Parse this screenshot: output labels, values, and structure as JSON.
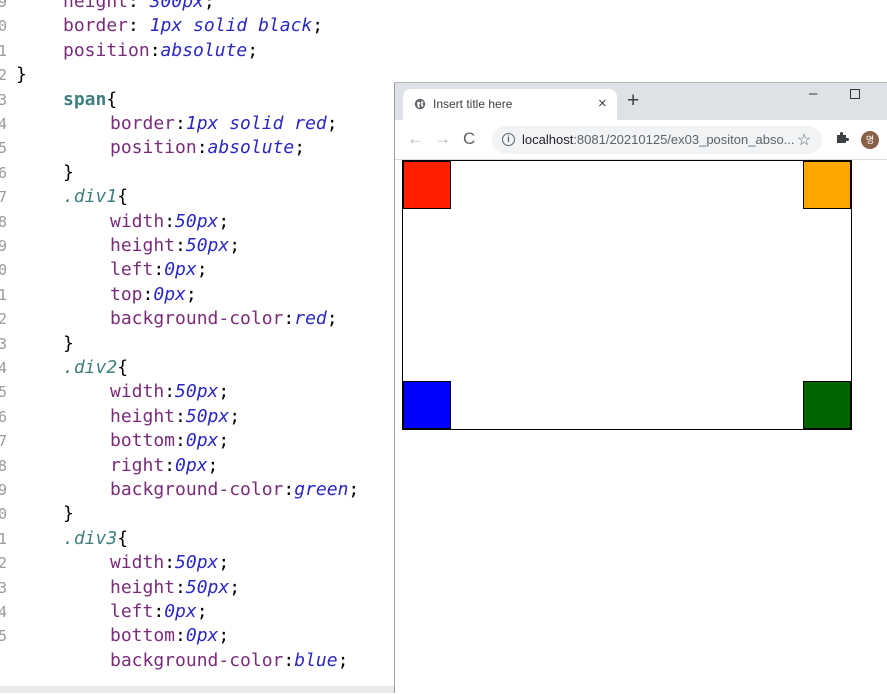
{
  "editor": {
    "line_numbers": [
      "9",
      "0",
      "1",
      "2",
      "3",
      "4",
      "5",
      "6",
      "7",
      "8",
      "9",
      "0",
      "1",
      "2",
      "3",
      "4",
      "5",
      "6",
      "7",
      "8",
      "9",
      "0",
      "1",
      "2",
      "3",
      "4",
      "5"
    ],
    "lines": [
      {
        "indent": 1,
        "tokens": [
          [
            "prop",
            "height"
          ],
          [
            "punc",
            ": "
          ],
          [
            "val",
            "300px"
          ],
          [
            "punc",
            ";"
          ]
        ]
      },
      {
        "indent": 1,
        "tokens": [
          [
            "prop",
            "border"
          ],
          [
            "punc",
            ": "
          ],
          [
            "val",
            "1px solid black"
          ],
          [
            "punc",
            ";"
          ]
        ]
      },
      {
        "indent": 1,
        "tokens": [
          [
            "prop",
            "position"
          ],
          [
            "punc",
            ":"
          ],
          [
            "val",
            "absolute"
          ],
          [
            "punc",
            ";"
          ]
        ]
      },
      {
        "indent": 0,
        "tokens": [
          [
            "punc",
            "}"
          ]
        ]
      },
      {
        "indent": 1,
        "tokens": [
          [
            "tag",
            "span"
          ],
          [
            "punc",
            "{"
          ]
        ]
      },
      {
        "indent": 2,
        "tokens": [
          [
            "prop",
            "border"
          ],
          [
            "punc",
            ":"
          ],
          [
            "val",
            "1px solid red"
          ],
          [
            "punc",
            ";"
          ]
        ]
      },
      {
        "indent": 2,
        "tokens": [
          [
            "prop",
            "position"
          ],
          [
            "punc",
            ":"
          ],
          [
            "val",
            "absolute"
          ],
          [
            "punc",
            ";"
          ]
        ]
      },
      {
        "indent": 1,
        "tokens": [
          [
            "punc",
            "}"
          ]
        ]
      },
      {
        "indent": 1,
        "tokens": [
          [
            "sel",
            ".div1"
          ],
          [
            "punc",
            "{"
          ]
        ]
      },
      {
        "indent": 2,
        "tokens": [
          [
            "prop",
            "width"
          ],
          [
            "punc",
            ":"
          ],
          [
            "val",
            "50px"
          ],
          [
            "punc",
            ";"
          ]
        ]
      },
      {
        "indent": 2,
        "tokens": [
          [
            "prop",
            "height"
          ],
          [
            "punc",
            ":"
          ],
          [
            "val",
            "50px"
          ],
          [
            "punc",
            ";"
          ]
        ]
      },
      {
        "indent": 2,
        "tokens": [
          [
            "prop",
            "left"
          ],
          [
            "punc",
            ":"
          ],
          [
            "val",
            "0px"
          ],
          [
            "punc",
            ";"
          ]
        ]
      },
      {
        "indent": 2,
        "tokens": [
          [
            "prop",
            "top"
          ],
          [
            "punc",
            ":"
          ],
          [
            "val",
            "0px"
          ],
          [
            "punc",
            ";"
          ]
        ]
      },
      {
        "indent": 2,
        "tokens": [
          [
            "prop",
            "background-color"
          ],
          [
            "punc",
            ":"
          ],
          [
            "val",
            "red"
          ],
          [
            "punc",
            ";"
          ]
        ]
      },
      {
        "indent": 1,
        "tokens": [
          [
            "punc",
            "}"
          ]
        ]
      },
      {
        "indent": 1,
        "tokens": [
          [
            "sel",
            ".div2"
          ],
          [
            "punc",
            "{"
          ]
        ]
      },
      {
        "indent": 2,
        "tokens": [
          [
            "prop",
            "width"
          ],
          [
            "punc",
            ":"
          ],
          [
            "val",
            "50px"
          ],
          [
            "punc",
            ";"
          ]
        ]
      },
      {
        "indent": 2,
        "tokens": [
          [
            "prop",
            "height"
          ],
          [
            "punc",
            ":"
          ],
          [
            "val",
            "50px"
          ],
          [
            "punc",
            ";"
          ]
        ]
      },
      {
        "indent": 2,
        "tokens": [
          [
            "prop",
            "bottom"
          ],
          [
            "punc",
            ":"
          ],
          [
            "val",
            "0px"
          ],
          [
            "punc",
            ";"
          ]
        ]
      },
      {
        "indent": 2,
        "tokens": [
          [
            "prop",
            "right"
          ],
          [
            "punc",
            ":"
          ],
          [
            "val",
            "0px"
          ],
          [
            "punc",
            ";"
          ]
        ]
      },
      {
        "indent": 2,
        "tokens": [
          [
            "prop",
            "background-color"
          ],
          [
            "punc",
            ":"
          ],
          [
            "val",
            "green"
          ],
          [
            "punc",
            ";"
          ]
        ]
      },
      {
        "indent": 1,
        "tokens": [
          [
            "punc",
            "}"
          ]
        ]
      },
      {
        "indent": 1,
        "tokens": [
          [
            "sel",
            ".div3"
          ],
          [
            "punc",
            "{"
          ]
        ]
      },
      {
        "indent": 2,
        "tokens": [
          [
            "prop",
            "width"
          ],
          [
            "punc",
            ":"
          ],
          [
            "val",
            "50px"
          ],
          [
            "punc",
            ";"
          ]
        ]
      },
      {
        "indent": 2,
        "tokens": [
          [
            "prop",
            "height"
          ],
          [
            "punc",
            ":"
          ],
          [
            "val",
            "50px"
          ],
          [
            "punc",
            ";"
          ]
        ]
      },
      {
        "indent": 2,
        "tokens": [
          [
            "prop",
            "left"
          ],
          [
            "punc",
            ":"
          ],
          [
            "val",
            "0px"
          ],
          [
            "punc",
            ";"
          ]
        ]
      },
      {
        "indent": 2,
        "tokens": [
          [
            "prop",
            "bottom"
          ],
          [
            "punc",
            ":"
          ],
          [
            "val",
            "0px"
          ],
          [
            "punc",
            ";"
          ]
        ]
      },
      {
        "indent": 2,
        "tokens": [
          [
            "prop",
            "background-color"
          ],
          [
            "punc",
            ":"
          ],
          [
            "val",
            "blue"
          ],
          [
            "punc",
            ";"
          ]
        ]
      }
    ]
  },
  "browser": {
    "tab": {
      "title": "Insert title here",
      "icon": "globe-icon",
      "close_glyph": "×"
    },
    "new_tab_glyph": "+",
    "window": {
      "minimize_glyph": "–"
    },
    "nav": {
      "back_glyph": "←",
      "forward_glyph": "→",
      "reload_glyph": "C"
    },
    "address": {
      "info_glyph": "i",
      "host": "localhost",
      "path": ":8081/20210125/ex03_positon_abso..."
    },
    "star_glyph": "☆",
    "extensions_icon": "puzzle-icon",
    "profile_initial": "명",
    "page": {
      "squares": [
        {
          "id": "red",
          "color": "#ff2000"
        },
        {
          "id": "orange",
          "color": "#ffa500"
        },
        {
          "id": "blue",
          "color": "#0000ff"
        },
        {
          "id": "green",
          "color": "#006400"
        }
      ]
    }
  }
}
